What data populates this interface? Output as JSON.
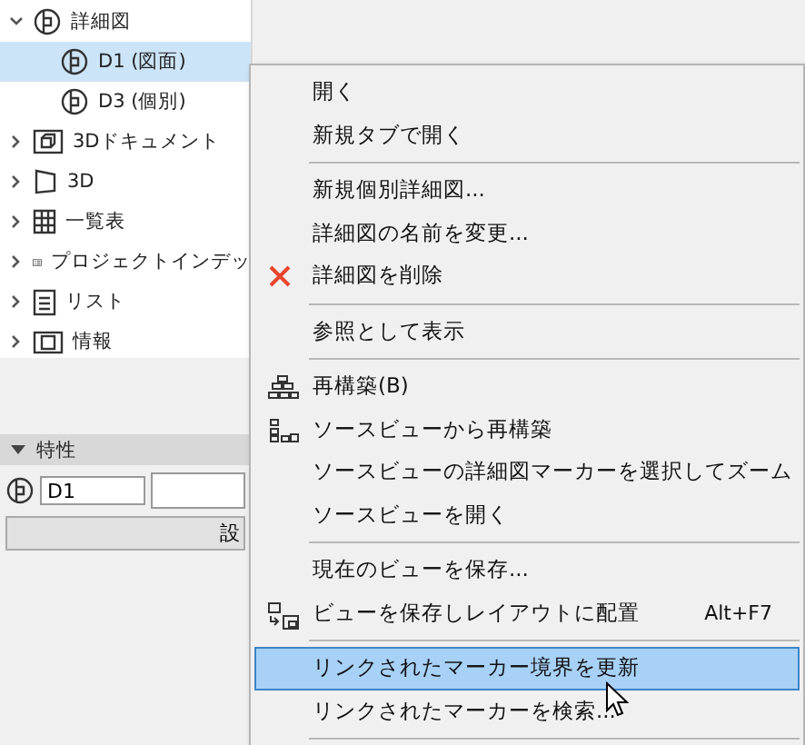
{
  "tree": [
    {
      "label": "詳細図",
      "kind": "detail",
      "expanded": true,
      "selected": false,
      "children": [
        {
          "label": "D1 (図面)",
          "kind": "detail",
          "selected": true
        },
        {
          "label": "D3 (個別)",
          "kind": "detail",
          "selected": false
        }
      ]
    },
    {
      "label": "3Dドキュメント",
      "kind": "doc3d",
      "expanded": false,
      "selected": false
    },
    {
      "label": "3D",
      "kind": "cube",
      "expanded": false,
      "selected": false
    },
    {
      "label": "一覧表",
      "kind": "grid",
      "expanded": false,
      "selected": false
    },
    {
      "label": "プロジェクトインデッ",
      "kind": "index",
      "expanded": false,
      "selected": false
    },
    {
      "label": "リスト",
      "kind": "list",
      "expanded": false,
      "selected": false
    },
    {
      "label": "情報",
      "kind": "info",
      "expanded": false,
      "selected": false
    }
  ],
  "properties": {
    "title": "特性",
    "expanded": true,
    "name_value": "D1",
    "button": "設"
  },
  "context_menu": [
    {
      "kind": "item",
      "label": "開く",
      "highlighted": false
    },
    {
      "kind": "item",
      "label": "新規タブで開く",
      "highlighted": false
    },
    {
      "kind": "separator"
    },
    {
      "kind": "item",
      "label": "新規個別詳細図...",
      "highlighted": false
    },
    {
      "kind": "item",
      "label": "詳細図の名前を変更...",
      "highlighted": false
    },
    {
      "kind": "delete",
      "label": "詳細図を削除",
      "highlighted": false
    },
    {
      "kind": "separator"
    },
    {
      "kind": "item",
      "label": "参照として表示",
      "highlighted": false
    },
    {
      "kind": "separator"
    },
    {
      "kind": "rebuild",
      "label": "再構築(B)",
      "highlighted": false
    },
    {
      "kind": "rebuild-source",
      "label": "ソースビューから再構築",
      "highlighted": false
    },
    {
      "kind": "item",
      "label": "ソースビューの詳細図マーカーを選択してズーム",
      "highlighted": false
    },
    {
      "kind": "item",
      "label": "ソースビューを開く",
      "highlighted": false
    },
    {
      "kind": "separator"
    },
    {
      "kind": "item",
      "label": "現在のビューを保存...",
      "highlighted": false
    },
    {
      "kind": "save-layout",
      "label": "ビューを保存しレイアウトに配置",
      "shortcut": "Alt+F7",
      "highlighted": false
    },
    {
      "kind": "separator"
    },
    {
      "kind": "item",
      "label": "リンクされたマーカー境界を更新",
      "highlighted": true
    },
    {
      "kind": "item",
      "label": "リンクされたマーカーを検索...",
      "highlighted": false
    },
    {
      "kind": "separator"
    }
  ]
}
